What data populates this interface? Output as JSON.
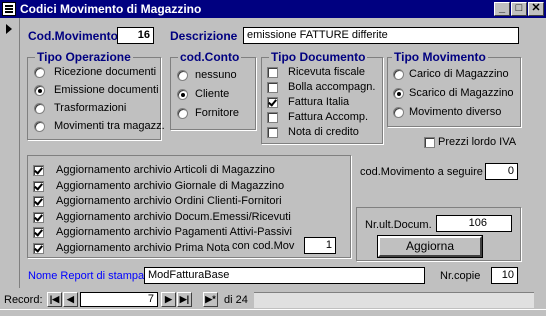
{
  "window": {
    "title": "Codici Movimento di Magazzino",
    "btn_min": "_",
    "btn_max": "□",
    "btn_close": "✕"
  },
  "header": {
    "cod_label": "Cod.Movimento",
    "cod_value": "16",
    "desc_label": "Descrizione",
    "desc_value": "emissione FATTURE differite"
  },
  "tipo_operazione": {
    "title": "Tipo Operazione",
    "options": [
      "Ricezione documenti",
      "Emissione documenti",
      "Trasformazioni",
      "Movimenti tra magazz."
    ],
    "selected": 1
  },
  "cod_conto": {
    "title": "cod.Conto",
    "options": [
      "nessuno",
      "Cliente",
      "Fornitore"
    ],
    "selected": 1
  },
  "tipo_documento": {
    "title": "Tipo Documento",
    "options": [
      "Ricevuta fiscale",
      "Bolla accompagn.",
      "Fattura Italia",
      "Fattura Accomp.",
      "Nota di credito"
    ],
    "checked": [
      false,
      false,
      true,
      false,
      false
    ]
  },
  "tipo_movimento": {
    "title": "Tipo Movimento",
    "options": [
      "Carico di Magazzino",
      "Scarico di Magazzino",
      "Movimento diverso"
    ],
    "selected": 1
  },
  "prezzi_lordo": {
    "label": "Prezzi lordo IVA",
    "checked": false
  },
  "aggiornamenti": {
    "items": [
      "Aggiornamento archivio Articoli di Magazzino",
      "Aggiornamento archivio Giornale di Magazzino",
      "Aggiornamento archivio Ordini Clienti-Fornitori",
      "Aggiornamento archivio Docum.Emessi/Ricevuti",
      "Aggiornamento archivio Pagamenti Attivi-Passivi",
      "Aggiornamento archivio Prima Nota"
    ],
    "checked": [
      true,
      true,
      true,
      true,
      true,
      true
    ],
    "con_cod_label": "con cod.Mov",
    "con_cod_value": "1"
  },
  "seguire": {
    "label": "cod.Movimento a seguire",
    "value": "0"
  },
  "ultimo_doc": {
    "label": "Nr.ult.Docum.",
    "value": "106",
    "button": "Aggiorna"
  },
  "report": {
    "label": "Nome Report di stampa",
    "value": "ModFatturaBase",
    "copie_label": "Nr.copie",
    "copie_value": "10"
  },
  "navigation": {
    "label": "Record:",
    "current": "7",
    "total": "di 24",
    "first": "|◀",
    "prev": "◀",
    "next": "▶",
    "last": "▶|",
    "new": "▶*"
  }
}
